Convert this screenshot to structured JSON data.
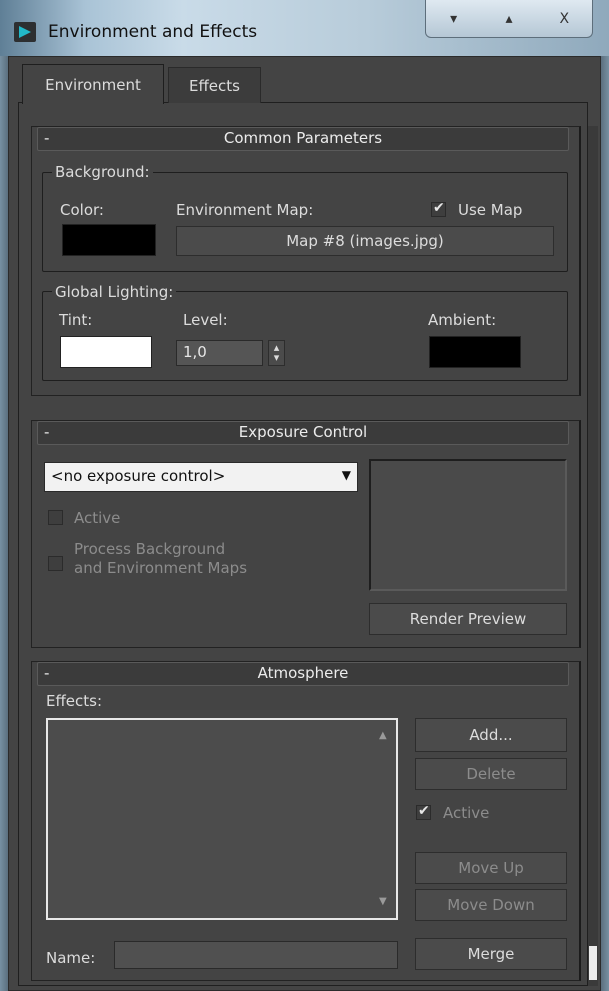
{
  "window": {
    "title": "Environment and Effects",
    "controls": [
      "▾",
      "▴",
      "X"
    ]
  },
  "tabs": [
    {
      "label": "Environment"
    },
    {
      "label": "Effects"
    }
  ],
  "common": {
    "title": "Common Parameters",
    "background": {
      "group_label": "Background:",
      "color_label": "Color:",
      "color": "#000000",
      "envmap_label": "Environment Map:",
      "use_map_label": "Use Map",
      "use_map_checked": true,
      "map_button": "Map #8 (images.jpg)"
    },
    "lighting": {
      "group_label": "Global Lighting:",
      "tint_label": "Tint:",
      "tint_color": "#ffffff",
      "level_label": "Level:",
      "level_value": "1,0",
      "ambient_label": "Ambient:",
      "ambient_color": "#000000"
    }
  },
  "exposure": {
    "title": "Exposure Control",
    "dropdown_value": "<no exposure control>",
    "active_label": "Active",
    "process_label_1": "Process Background",
    "process_label_2": "and Environment Maps",
    "render_preview": "Render Preview"
  },
  "atmosphere": {
    "title": "Atmosphere",
    "effects_label": "Effects:",
    "add_button": "Add...",
    "delete_button": "Delete",
    "active_label": "Active",
    "active_checked": true,
    "move_up": "Move Up",
    "move_down": "Move Down",
    "name_label": "Name:",
    "name_value": "",
    "merge_button": "Merge"
  },
  "rollout_minus": "-"
}
